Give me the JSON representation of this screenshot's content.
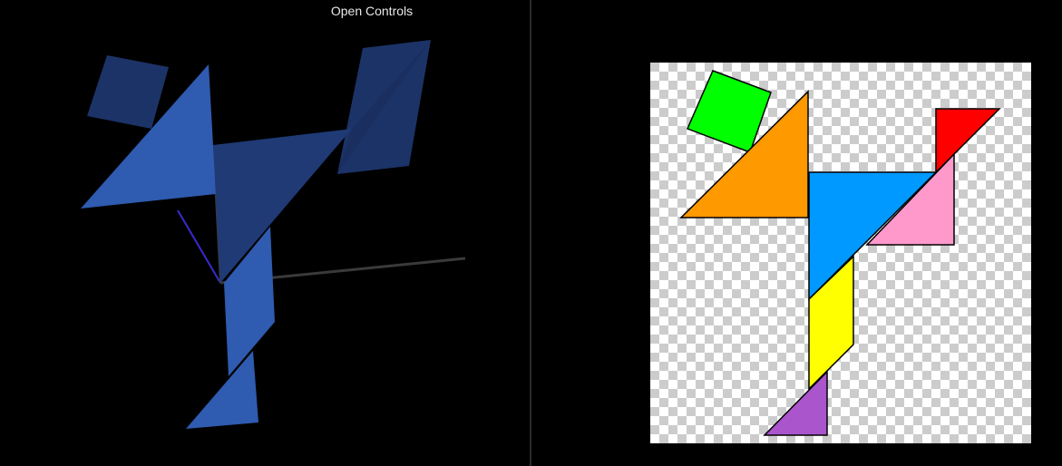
{
  "controls": {
    "open_label": "Open Controls"
  },
  "colors": {
    "background": "#000000",
    "divider": "#2a2a2a",
    "piece_3d_light": "#2f5bb0",
    "piece_3d_dark": "#1c3367",
    "tangram": {
      "green_square": "#00ff00",
      "orange_triangle": "#ff9900",
      "red_triangle": "#ff0000",
      "blue_triangle": "#0099ff",
      "pink_triangle": "#ff99cc",
      "yellow_parallelogram": "#ffff00",
      "purple_triangle": "#aa55cc"
    }
  },
  "checker": {
    "light": "#ffffff",
    "dark": "#cccccc"
  }
}
